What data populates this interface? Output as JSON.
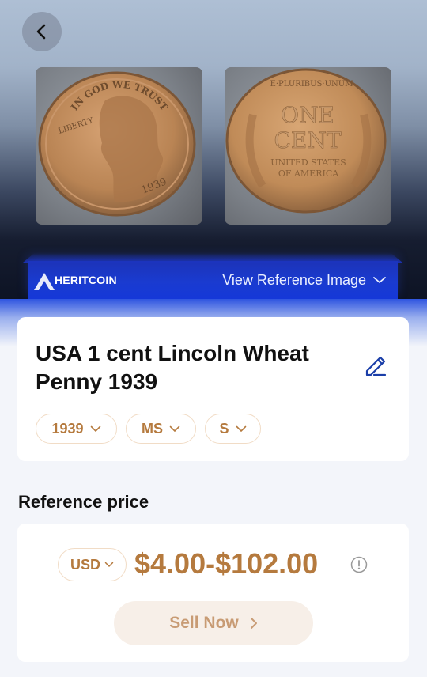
{
  "header": {
    "back_icon": "chevron-left-icon"
  },
  "images": {
    "front_coin": {
      "legend": "IN GOD WE TRUST",
      "liberty": "LIBERTY",
      "year": "1939"
    },
    "back_coin": {
      "top": "E·PLURIBUS·UNUM",
      "denomination_line1": "ONE",
      "denomination_line2": "CENT",
      "country_line1": "UNITED STATES",
      "country_line2": "OF AMERICA"
    }
  },
  "banner": {
    "brand": "HERITCOIN",
    "view_reference_label": "View Reference Image",
    "accent_color": "#1a3bd0"
  },
  "coin": {
    "title": "USA 1 cent  Lincoln Wheat Penny 1939",
    "edit_icon": "edit-pencil-icon",
    "filters": {
      "year": "1939",
      "grade": "MS",
      "mint": "S"
    }
  },
  "reference_price": {
    "section_title": "Reference price",
    "currency": "USD",
    "price_range": "$4.00-$102.00",
    "info_icon": "info-circle-icon",
    "sell_button_label": "Sell Now",
    "price_color": "#b57a3e"
  }
}
